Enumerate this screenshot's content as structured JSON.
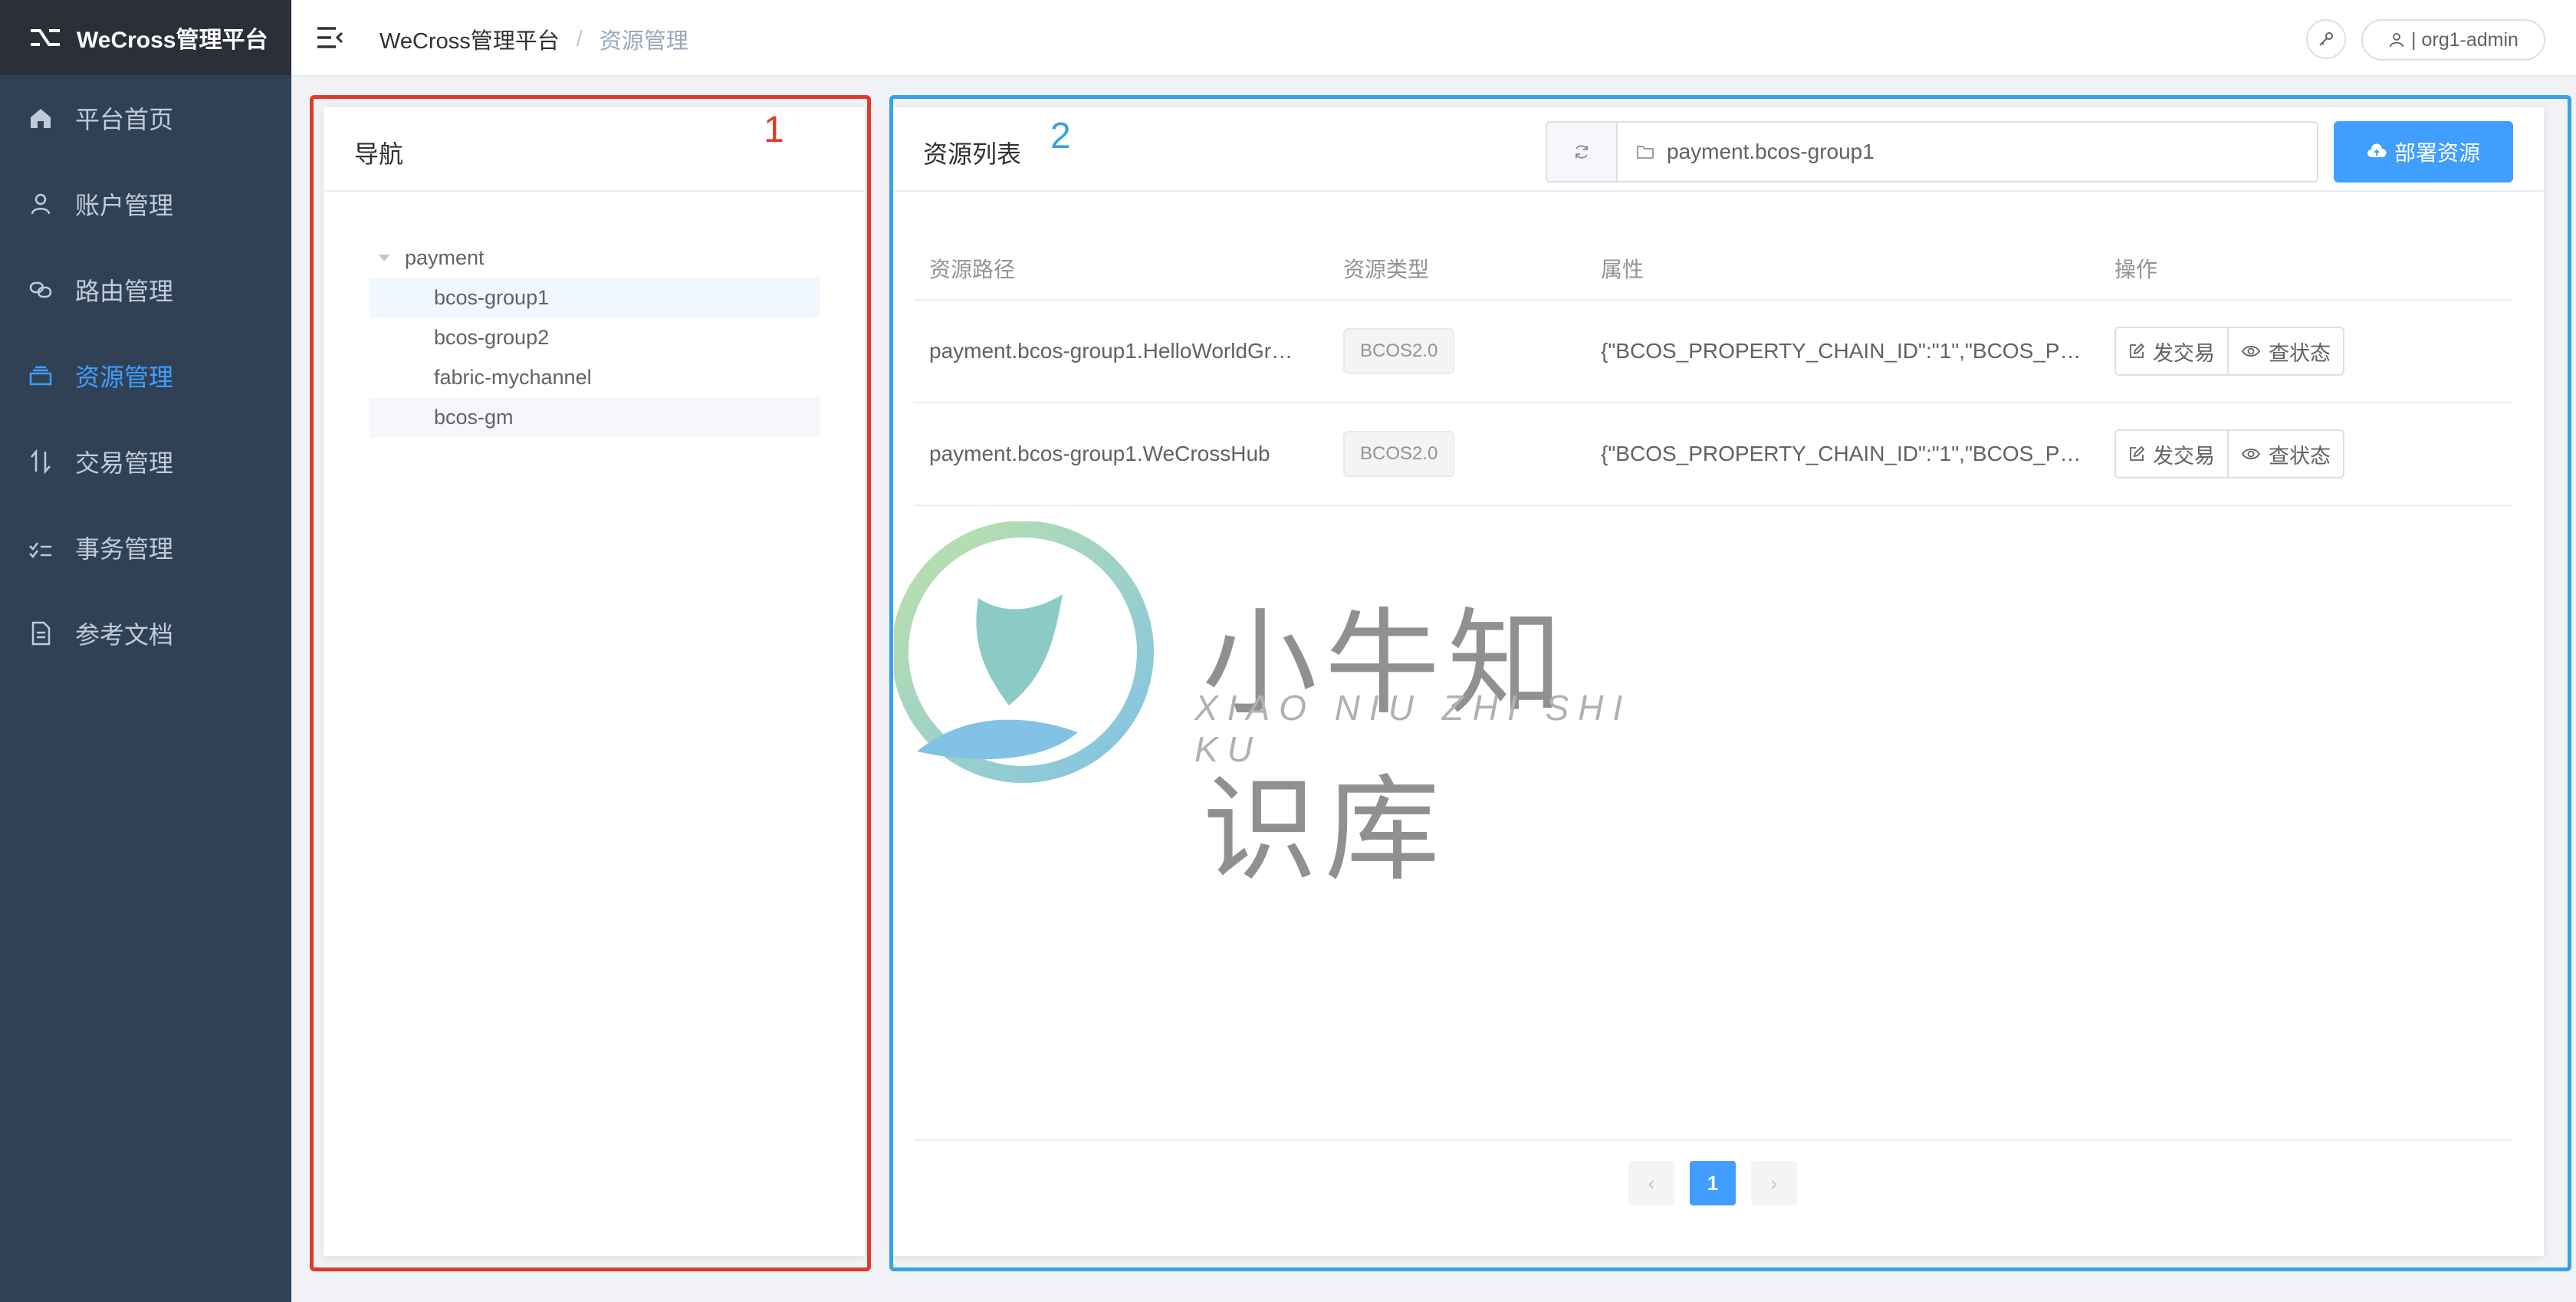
{
  "app": {
    "title": "WeCross管理平台"
  },
  "menu": {
    "items": [
      {
        "label": "平台首页",
        "icon": "home-icon"
      },
      {
        "label": "账户管理",
        "icon": "user-icon"
      },
      {
        "label": "路由管理",
        "icon": "link-icon"
      },
      {
        "label": "资源管理",
        "icon": "layers-icon",
        "active": true
      },
      {
        "label": "交易管理",
        "icon": "sort-icon"
      },
      {
        "label": "事务管理",
        "icon": "checklist-icon"
      },
      {
        "label": "参考文档",
        "icon": "document-icon"
      }
    ]
  },
  "breadcrumb": {
    "home": "WeCross管理平台",
    "separator": "/",
    "current": "资源管理"
  },
  "user": {
    "label": "| org1-admin"
  },
  "nav_panel": {
    "title": "导航",
    "tree": {
      "root": "payment",
      "children": [
        "bcos-group1",
        "bcos-group2",
        "fabric-mychannel",
        "bcos-gm"
      ]
    }
  },
  "resource_panel": {
    "title": "资源列表",
    "path_value": "payment.bcos-group1",
    "deploy_label": "部署资源",
    "columns": [
      "资源路径",
      "资源类型",
      "属性",
      "操作"
    ],
    "rows": [
      {
        "path": "payment.bcos-group1.HelloWorldGr…",
        "type": "BCOS2.0",
        "properties": "{\"BCOS_PROPERTY_CHAIN_ID\":\"1\",\"BCOS_P…",
        "send_label": "发交易",
        "status_label": "查状态"
      },
      {
        "path": "payment.bcos-group1.WeCrossHub",
        "type": "BCOS2.0",
        "properties": "{\"BCOS_PROPERTY_CHAIN_ID\":\"1\",\"BCOS_P…",
        "send_label": "发交易",
        "status_label": "查状态"
      }
    ],
    "pagination": {
      "prev": "‹",
      "current": "1",
      "next": "›"
    }
  },
  "annotations": {
    "box1": "1",
    "box2": "2"
  },
  "watermark": {
    "cn": "小牛知识库",
    "en": "XIAO NIU ZHI SHI KU"
  },
  "colors": {
    "sidebar": "#304156",
    "accent": "#409eff",
    "box_red": "#e03b28",
    "box_blue": "#39a2e6"
  }
}
